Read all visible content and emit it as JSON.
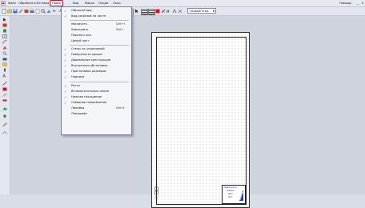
{
  "menubar": {
    "items": [
      {
        "label": "Файл"
      },
      {
        "label": "Обработать"
      },
      {
        "label": "Вставка"
      },
      {
        "label": "Поиск"
      },
      {
        "label": "Вид"
      },
      {
        "label": "Макро"
      },
      {
        "label": "Опции"
      },
      {
        "label": "Окно"
      }
    ],
    "active_index": 3,
    "help_label": "Помощь"
  },
  "toolbar": {
    "layer_combo": "Первый этаж"
  },
  "view_menu": {
    "items": [
      {
        "label": "Обычный вид",
        "checked": true,
        "shortcut": ""
      },
      {
        "label": "Вид разрезов на листе",
        "checked": true,
        "shortcut": ""
      },
      {
        "label": "Увеличить",
        "checked": false,
        "shortcut": "Ctrl++"
      },
      {
        "label": "Уменьшить",
        "checked": false,
        "shortcut": "Ctrl+-"
      },
      {
        "label": "Показать все",
        "checked": false,
        "shortcut": ""
      },
      {
        "label": "Целый лист",
        "checked": false,
        "shortcut": ""
      },
      {
        "label": "Стены со штриховкой",
        "checked": true,
        "shortcut": ""
      },
      {
        "label": "Поверхности крыши",
        "checked": true,
        "shortcut": ""
      },
      {
        "label": "Деревянные конструкции",
        "checked": true,
        "shortcut": ""
      },
      {
        "label": "Внутренняя обстановка",
        "checked": true,
        "shortcut": ""
      },
      {
        "label": "Простановка размеров",
        "checked": true,
        "shortcut": ""
      },
      {
        "label": "Надписи",
        "checked": true,
        "shortcut": ""
      },
      {
        "label": "Растр",
        "checked": true,
        "shortcut": ""
      },
      {
        "label": "Вспомогательные линии",
        "checked": true,
        "shortcut": ""
      },
      {
        "label": "Нижнее насыщение",
        "checked": true,
        "shortcut": ""
      },
      {
        "label": "Северное направление",
        "checked": true,
        "shortcut": ""
      },
      {
        "label": "Линейка",
        "checked": false,
        "shortcut": "Ctrl+L"
      },
      {
        "label": "Лендшафт",
        "checked": false,
        "shortcut": ""
      }
    ]
  },
  "title_block": {
    "lines": [
      "Новый проект",
      "Подпись",
      "Дата",
      "Лист"
    ]
  },
  "colors": {
    "accent": "#c0152a",
    "check": "#2d56b8",
    "logo": "#2136b8"
  }
}
